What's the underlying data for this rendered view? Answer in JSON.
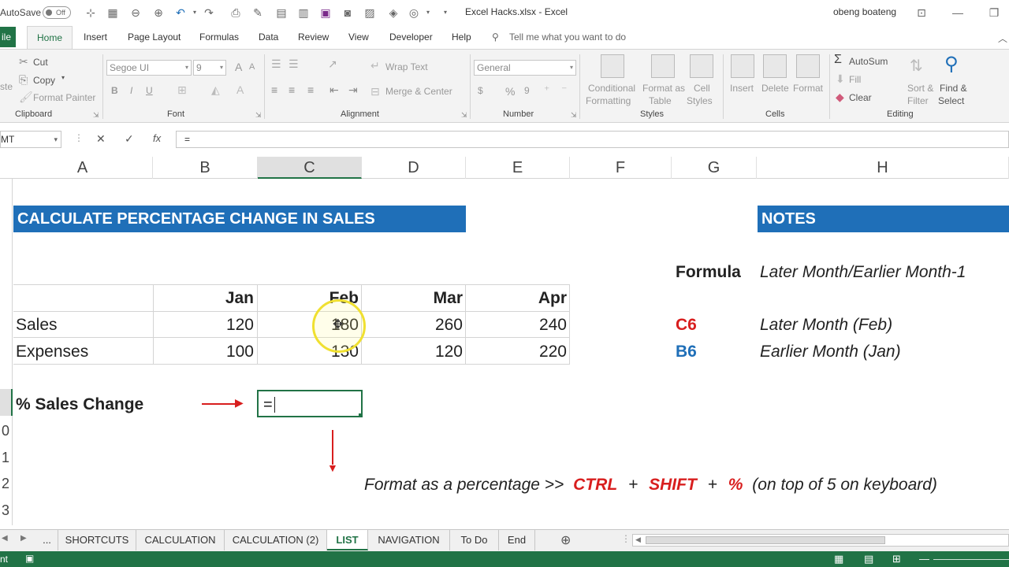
{
  "titlebar": {
    "autosave_label": "AutoSave",
    "autosave_state": "Off",
    "filename": "Excel Hacks.xlsx",
    "separator": "-",
    "app": "Excel",
    "user": "obeng boateng"
  },
  "menu": {
    "file": "ile",
    "tabs": [
      "Home",
      "Insert",
      "Page Layout",
      "Formulas",
      "Data",
      "Review",
      "View",
      "Developer",
      "Help"
    ],
    "tell_me": "Tell me what you want to do"
  },
  "ribbon": {
    "clipboard": {
      "cut": "Cut",
      "copy": "Copy",
      "format_painter": "Format Painter",
      "paste_stub": "ste",
      "label": "Clipboard"
    },
    "font": {
      "name": "Segoe UI",
      "size": "9",
      "bold": "B",
      "italic": "I",
      "underline": "U",
      "label": "Font",
      "grow": "A",
      "shrink": "A"
    },
    "alignment": {
      "wrap": "Wrap Text",
      "merge": "Merge & Center",
      "label": "Alignment"
    },
    "number": {
      "format": "General",
      "currency": "$",
      "percent": "%",
      "comma": "9",
      "label": "Number"
    },
    "styles": {
      "conditional": "Conditional",
      "formatting": "Formatting",
      "format_as": "Format as",
      "table": "Table",
      "cell": "Cell",
      "styles": "Styles",
      "label": "Styles"
    },
    "cells": {
      "insert": "Insert",
      "delete": "Delete",
      "format": "Format",
      "label": "Cells"
    },
    "editing": {
      "autosum": "AutoSum",
      "fill": "Fill",
      "clear": "Clear",
      "sort": "Sort &",
      "filter": "Filter",
      "find": "Find &",
      "select": "Select",
      "label": "Editing"
    }
  },
  "formulabar": {
    "namebox": "MT",
    "cancel": "✕",
    "enter": "✓",
    "fx": "fx",
    "value": "="
  },
  "columns": [
    "A",
    "B",
    "C",
    "D",
    "E",
    "F",
    "G",
    "H"
  ],
  "rows": [
    "0",
    "1",
    "2",
    "3"
  ],
  "sheet": {
    "banner_left": "CALCULATE PERCENTAGE CHANGE IN SALES",
    "banner_right": "NOTES",
    "months": [
      "Jan",
      "Feb",
      "Mar",
      "Apr"
    ],
    "sales_label": "Sales",
    "sales": [
      "120",
      "180",
      "260",
      "240"
    ],
    "expenses_label": "Expenses",
    "expenses": [
      "100",
      "130",
      "120",
      "220"
    ],
    "pct_label": "% Sales Change",
    "active_input": "=",
    "notes": {
      "formula_label": "Formula",
      "formula_value": "Later Month/Earlier Month-1",
      "c6_label": "C6",
      "c6_value": "Later Month (Feb)",
      "b6_label": "B6",
      "b6_value": "Earlier Month (Jan)"
    },
    "tip": {
      "prefix": "Format as a percentage >>",
      "ctrl": "CTRL",
      "plus1": "+",
      "shift": "SHIFT",
      "plus2": "+",
      "percent": "%",
      "suffix": "(on top of 5 on keyboard)"
    }
  },
  "tabs": {
    "ellipsis": "...",
    "items": [
      "SHORTCUTS",
      "CALCULATION",
      "CALCULATION (2)",
      "LIST",
      "NAVIGATION",
      "To Do",
      "End"
    ],
    "active": "LIST"
  },
  "status": {
    "mode": "nt"
  },
  "colors": {
    "excel_green": "#217346",
    "banner_blue": "#1f6fb8",
    "red": "#d81e1e",
    "blue": "#1f6fb8"
  }
}
